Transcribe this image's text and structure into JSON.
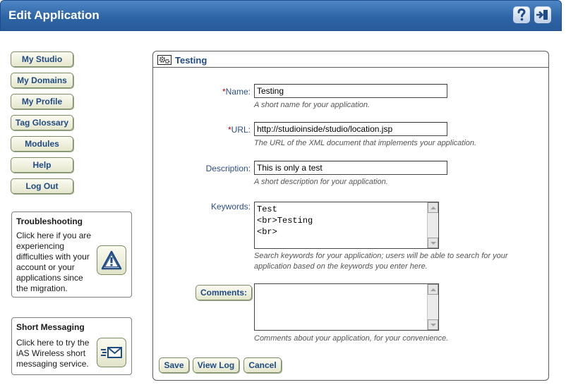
{
  "header": {
    "title": "Edit Application",
    "help_icon": "question-mark-icon",
    "exit_icon": "exit-door-icon",
    "color": "#2e65a6"
  },
  "nav": {
    "items": [
      {
        "label": "My Studio"
      },
      {
        "label": "My Domains"
      },
      {
        "label": "My Profile"
      },
      {
        "label": "Tag Glossary"
      },
      {
        "label": "Modules"
      },
      {
        "label": "Help"
      },
      {
        "label": "Log Out"
      }
    ]
  },
  "troubleshooting": {
    "title": "Troubleshooting",
    "lines": [
      "Click here if you are",
      "experiencing",
      "difficulties with your",
      "account or your",
      "applications since",
      "the migration."
    ],
    "icon": "warning-triangle-icon"
  },
  "messaging": {
    "title": "Short Messaging",
    "lines": [
      "Click here to try the",
      "iAS Wireless short",
      "messaging service."
    ],
    "icon": "envelope-icon"
  },
  "panel": {
    "title": "Testing",
    "icon": "gears-icon"
  },
  "form": {
    "name": {
      "req": "*",
      "label": "Name:",
      "value": "Testing",
      "hint": "A short name for your application."
    },
    "url": {
      "req": "*",
      "label": "URL:",
      "value": "http://studioinside/studio/location.jsp",
      "hint": "The URL of the XML document that implements your application."
    },
    "description": {
      "label": "Description:",
      "value": "This is only a test",
      "hint": "A short description for your application."
    },
    "keywords": {
      "label": "Keywords:",
      "value": "Test\n<br>Testing\n<br>",
      "hint_line1": "Search keywords for your application; users will be able to search for your",
      "hint_line2": "application based on the keywords you enter here."
    },
    "comments": {
      "label": "Comments:",
      "value": "",
      "hint": "Comments about your application, for your convenience."
    }
  },
  "actions": {
    "save": "Save",
    "view_log": "View Log",
    "cancel": "Cancel"
  }
}
